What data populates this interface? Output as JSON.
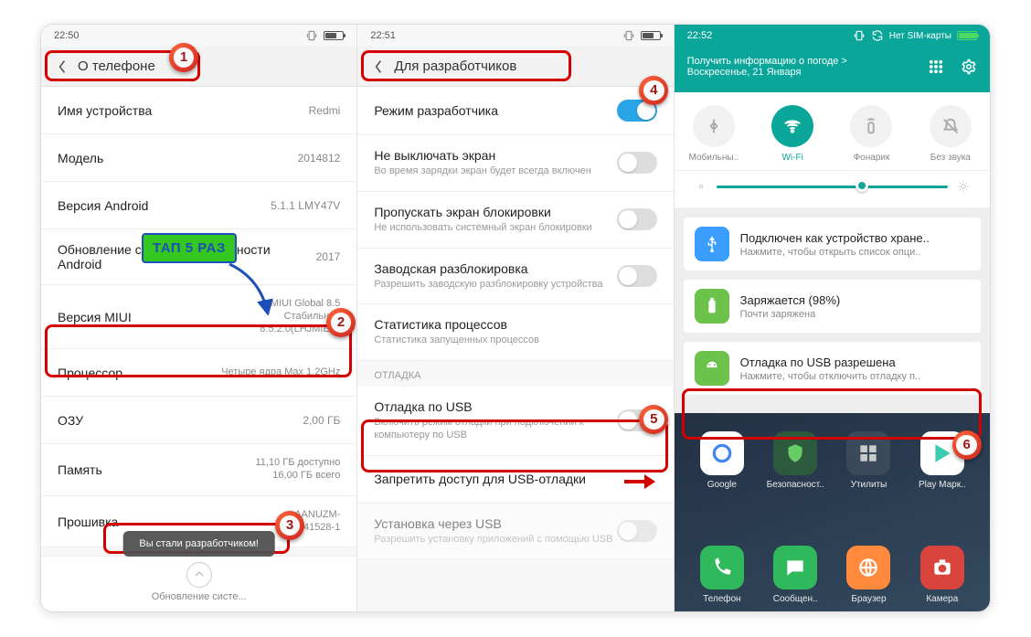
{
  "panel1": {
    "statusbar": {
      "time": "22:50"
    },
    "header": {
      "title": "О телефоне"
    },
    "rows": {
      "device_name": {
        "label": "Имя устройства",
        "value": "Redmi"
      },
      "model": {
        "label": "Модель",
        "value": "2014812"
      },
      "android": {
        "label": "Версия Android",
        "value": "5.1.1   LMY47V"
      },
      "security": {
        "label": "Обновление системы безопасности Android",
        "value": "2017"
      },
      "miui": {
        "label": "Версия MIUI",
        "value1": "MIUI Global 8.5",
        "value2": "Стабильная",
        "value3": "8.5.2.0(LHJMIED)"
      },
      "cpu": {
        "label": "Процессор",
        "value": "Четыре ядра Max 1,2GHz"
      },
      "ram": {
        "label": "ОЗУ",
        "value": "2,00 ГБ"
      },
      "storage": {
        "label": "Память",
        "value1": "11,10 ГБ доступно",
        "value2": "16,00 ГБ всего"
      },
      "firmware": {
        "label": "Прошивка",
        "value1": "AANUZM-",
        "value2": "1.7.1 41528-1"
      }
    },
    "toast": "Вы стали разработчиком!",
    "callout": "ТАП 5 РАЗ",
    "scroll_hint": "Обновление систе..."
  },
  "panel2": {
    "statusbar": {
      "time": "22:51"
    },
    "header": {
      "title": "Для разработчиков"
    },
    "rows": {
      "dev_mode": {
        "label": "Режим разработчика"
      },
      "stay_awake": {
        "label": "Не выключать экран",
        "sub": "Во время зарядки экран будет всегда включен"
      },
      "skip_lock": {
        "label": "Пропускать экран блокировки",
        "sub": "Не использовать системный экран блокировки"
      },
      "oem": {
        "label": "Заводская разблокировка",
        "sub": "Разрешить заводскую разблокировку устройства"
      },
      "stats": {
        "label": "Статистика процессов",
        "sub": "Статистика запущенных процессов"
      },
      "section_debug": "ОТЛАДКА",
      "usb_debug": {
        "label": "Отладка по USB",
        "sub": "Включить режим отладки при подключении к компьютеру по USB"
      },
      "revoke": {
        "label": "Запретить доступ для USB-отладки"
      },
      "install_usb": {
        "label": "Установка через USB",
        "sub": "Разрешить установку приложений с помощью USB"
      }
    }
  },
  "panel3": {
    "statusbar": {
      "time": "22:52",
      "sim_text": "Нет SIM-карты"
    },
    "weather": {
      "line1": "Получить информацию о погоде >",
      "line2": "Воскресенье, 21 Января"
    },
    "tiles": {
      "data": "Мобильны..",
      "wifi": "Wi-Fi",
      "torch": "Фонарик",
      "silent": "Без звука"
    },
    "notifs": {
      "usb_storage": {
        "title": "Подключен как устройство хране..",
        "sub": "Нажмите, чтобы открыть список опци.."
      },
      "charging": {
        "title": "Заряжается (98%)",
        "sub": "Почти заряжена"
      },
      "debug_allowed": {
        "title": "Отладка по USB разрешена",
        "sub": "Нажмите, чтобы отключить отладку п.."
      }
    },
    "apps_top": {
      "google": "Google",
      "security": "Безопасност..",
      "tools": "Утилиты",
      "play": "Play Марк.."
    },
    "apps_bottom": {
      "phone": "Телефон",
      "msg": "Сообщен..",
      "browser": "Браузер",
      "camera": "Камера"
    }
  },
  "badges": [
    "1",
    "2",
    "3",
    "4",
    "5",
    "6"
  ]
}
